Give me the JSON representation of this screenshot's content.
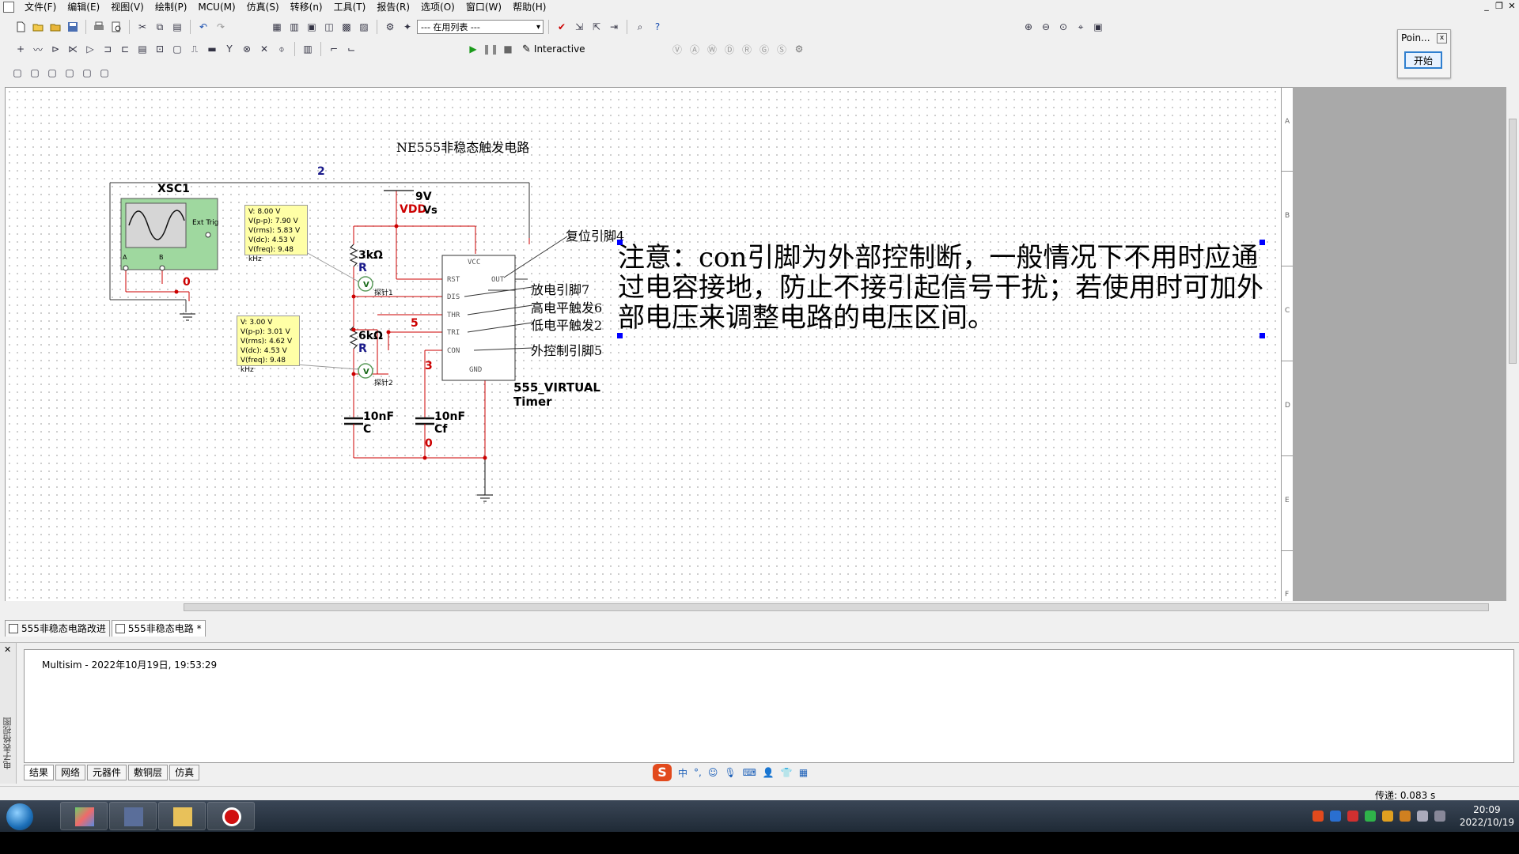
{
  "menu": [
    "文件(F)",
    "编辑(E)",
    "视图(V)",
    "绘制(P)",
    "MCU(M)",
    "仿真(S)",
    "转移(n)",
    "工具(T)",
    "报告(R)",
    "选项(O)",
    "窗口(W)",
    "帮助(H)"
  ],
  "toolbar": {
    "inuse_list": "--- 在用列表 ---",
    "interactive_label": "Interactive"
  },
  "point_panel": {
    "title": "Poin...",
    "close": "x",
    "start": "开始"
  },
  "schematic": {
    "title": "NE555非稳态触发电路",
    "oscilloscope": {
      "name": "XSC1",
      "ext_trig": "Ext Trig",
      "ch_a": "A",
      "ch_b": "B"
    },
    "net_labels": {
      "n2": "2",
      "n0a": "0",
      "n5": "5",
      "n3": "3",
      "n0b": "0"
    },
    "supply": {
      "value": "9V",
      "name": "VDD",
      "sub": "Vs"
    },
    "r1": {
      "value": "3kΩ",
      "ref": "R"
    },
    "r2": {
      "value": "6kΩ",
      "ref": "R"
    },
    "c1": {
      "value": "10nF",
      "ref": "C"
    },
    "c2": {
      "value": "10nF",
      "ref": "Cf"
    },
    "probe1": {
      "lines": [
        "V: 8.00 V",
        "V(p-p): 7.90 V",
        "V(rms): 5.83 V",
        "V(dc): 4.53 V",
        "V(freq): 9.48 kHz"
      ],
      "tag": "探针1"
    },
    "probe2": {
      "lines": [
        "V: 3.00 V",
        "V(p-p): 3.01 V",
        "V(rms): 4.62 V",
        "V(dc): 4.53 V",
        "V(freq): 9.48 kHz"
      ],
      "tag": "探针2"
    },
    "chip": {
      "name": "555_VIRTUAL",
      "sub": "Timer",
      "pins": {
        "vcc": "VCC",
        "rst": "RST",
        "out": "OUT",
        "dis": "DIS",
        "thr": "THR",
        "tri": "TRI",
        "con": "CON",
        "gnd": "GND"
      }
    },
    "annotations": {
      "reset": "复位引脚4",
      "discharge": "放电引脚7",
      "high_trigger": "高电平触发6",
      "low_trigger": "低电平触发2",
      "ext_control": "外控制引脚5"
    },
    "note": "注意：con引脚为外部控制断，一般情况下不用时应通过电容接地，防止不接引起信号干扰；若使用时可加外部电压来调整电路的电压区间。",
    "ruler_marks": [
      "A",
      "B",
      "C",
      "D",
      "E",
      "F"
    ]
  },
  "doc_tabs": [
    "555非稳态电路改进",
    "555非稳态电路 *"
  ],
  "log": {
    "line": "Multisim  -  2022年10月19日, 19:53:29",
    "side_label": "电子表格视图"
  },
  "bottom_tabs": [
    "结果",
    "网络",
    "元器件",
    "敷铜层",
    "仿真"
  ],
  "ime": {
    "logo": "S",
    "mode": "中",
    "punct": "°,"
  },
  "status": {
    "transfer": "传递: 0.083 s"
  },
  "clock": {
    "time": "20:09",
    "date": "2022/10/19"
  },
  "colors": {
    "wire": "#cc0000",
    "probe_bg": "#ffffa6",
    "scope_bg": "#9fd89f",
    "selection": "#0000ff"
  }
}
